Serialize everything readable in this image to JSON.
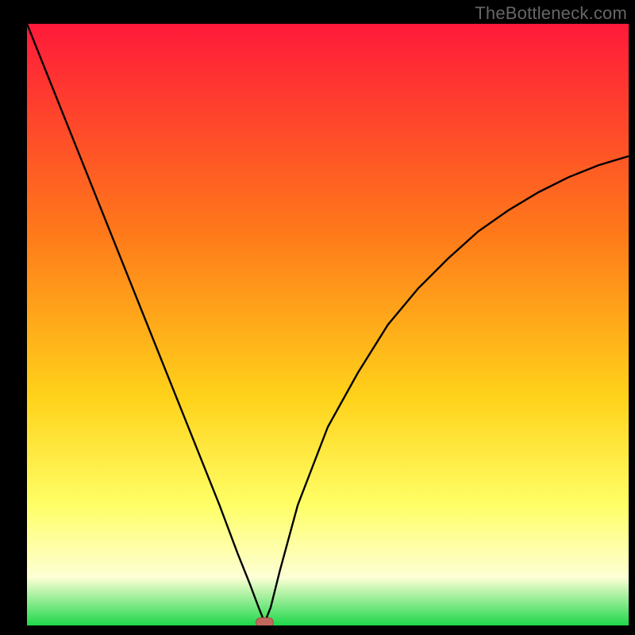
{
  "watermark": "TheBottleneck.com",
  "colors": {
    "bg_black": "#000000",
    "grad_top": "#ff1a3a",
    "grad_mid1": "#ff7a1a",
    "grad_mid2": "#ffd21a",
    "grad_mid3": "#ffff66",
    "grad_mid4": "#fdffd5",
    "grad_bottom": "#1fd84a",
    "curve": "#000000",
    "marker_fill": "#c06a5f",
    "marker_stroke": "#9a4d44"
  },
  "chart_data": {
    "type": "line",
    "title": "",
    "xlabel": "",
    "ylabel": "",
    "xlim": [
      0,
      100
    ],
    "ylim": [
      0,
      100
    ],
    "grid": false,
    "legend": false,
    "notes": "Bottleneck-style V curve over a vertical rainbow gradient. No axis ticks or labels present. Optimal (minimum) near x≈39.5. Values are estimated from pixels; axes unlabeled so treated as 0–100 percent.",
    "series": [
      {
        "name": "bottleneck-curve",
        "x": [
          0,
          4,
          8,
          12,
          16,
          20,
          24,
          28,
          32,
          35,
          37,
          38.5,
          39.5,
          40.5,
          42,
          45,
          50,
          55,
          60,
          65,
          70,
          75,
          80,
          85,
          90,
          95,
          100
        ],
        "y": [
          100,
          90,
          80,
          70,
          60,
          50,
          40,
          30,
          20,
          12,
          7,
          3,
          0.5,
          3,
          9,
          20,
          33,
          42,
          50,
          56,
          61,
          65.5,
          69,
          72,
          74.5,
          76.5,
          78
        ]
      }
    ],
    "annotations": [
      {
        "name": "optimal-marker",
        "x": 39.5,
        "y": 0.5
      }
    ]
  }
}
